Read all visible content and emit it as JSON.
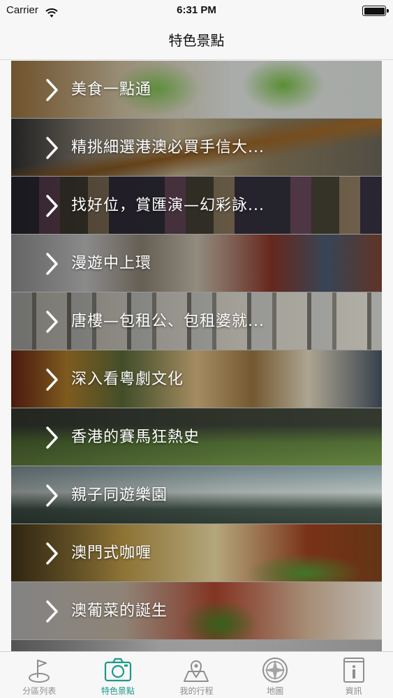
{
  "status_bar": {
    "carrier": "Carrier",
    "time": "6:31 PM"
  },
  "nav": {
    "title": "特色景點"
  },
  "list": {
    "items": [
      {
        "label": "美食一點通"
      },
      {
        "label": "精挑細選港澳必買手信大..."
      },
      {
        "label": "找好位，賞匯演—幻彩詠..."
      },
      {
        "label": "漫遊中上環"
      },
      {
        "label": "唐樓—包租公、包租婆就..."
      },
      {
        "label": "深入看粵劇文化"
      },
      {
        "label": "香港的賽馬狂熱史"
      },
      {
        "label": "親子同遊樂園"
      },
      {
        "label": "澳門式咖喱"
      },
      {
        "label": "澳葡菜的誕生"
      }
    ]
  },
  "tabbar": {
    "active_color": "#1a9a8a",
    "inactive_color": "#8e8e8e",
    "tabs": [
      {
        "label": "分區列表",
        "icon": "flag-map-icon",
        "active": false
      },
      {
        "label": "特色景點",
        "icon": "camera-icon",
        "active": true
      },
      {
        "label": "我的行程",
        "icon": "map-pin-icon",
        "active": false
      },
      {
        "label": "地圖",
        "icon": "compass-icon",
        "active": false
      },
      {
        "label": "資訊",
        "icon": "info-icon",
        "active": false
      }
    ]
  }
}
